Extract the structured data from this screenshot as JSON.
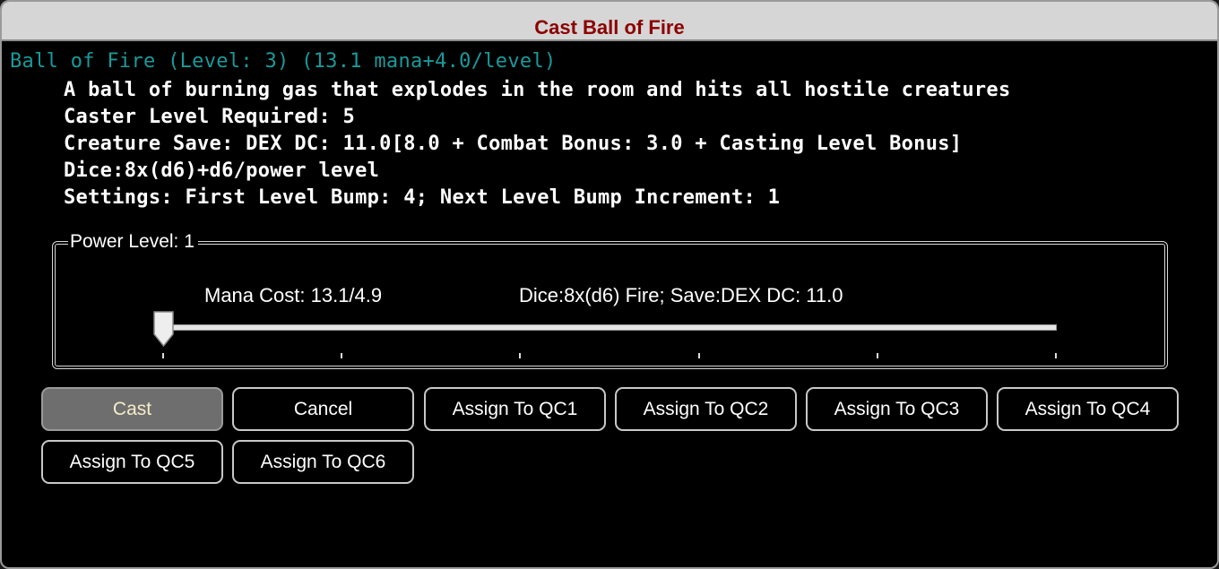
{
  "window": {
    "title": "Cast Ball of Fire"
  },
  "spell": {
    "heading": "Ball of Fire (Level: 3) (13.1 mana+4.0/level)",
    "lines": [
      "A ball of burning gas that explodes in the room and hits all hostile creatures",
      "Caster Level Required: 5",
      "Creature Save: DEX DC: 11.0[8.0 + Combat Bonus: 3.0 + Casting Level Bonus]",
      "Dice:8x(d6)+d6/power level",
      "Settings: First Level Bump: 4; Next Level Bump Increment: 1"
    ]
  },
  "power": {
    "legend": "Power Level: 1",
    "mana_cost": "Mana Cost: 13.1/4.9",
    "dice_save": "Dice:8x(d6) Fire;  Save:DEX DC: 11.0",
    "slider": {
      "min": 1,
      "max": 6,
      "value": 1
    }
  },
  "buttons": [
    "Cast",
    "Cancel",
    "Assign To QC1",
    "Assign To QC2",
    "Assign To QC3",
    "Assign To QC4",
    "Assign To QC5",
    "Assign To QC6"
  ]
}
